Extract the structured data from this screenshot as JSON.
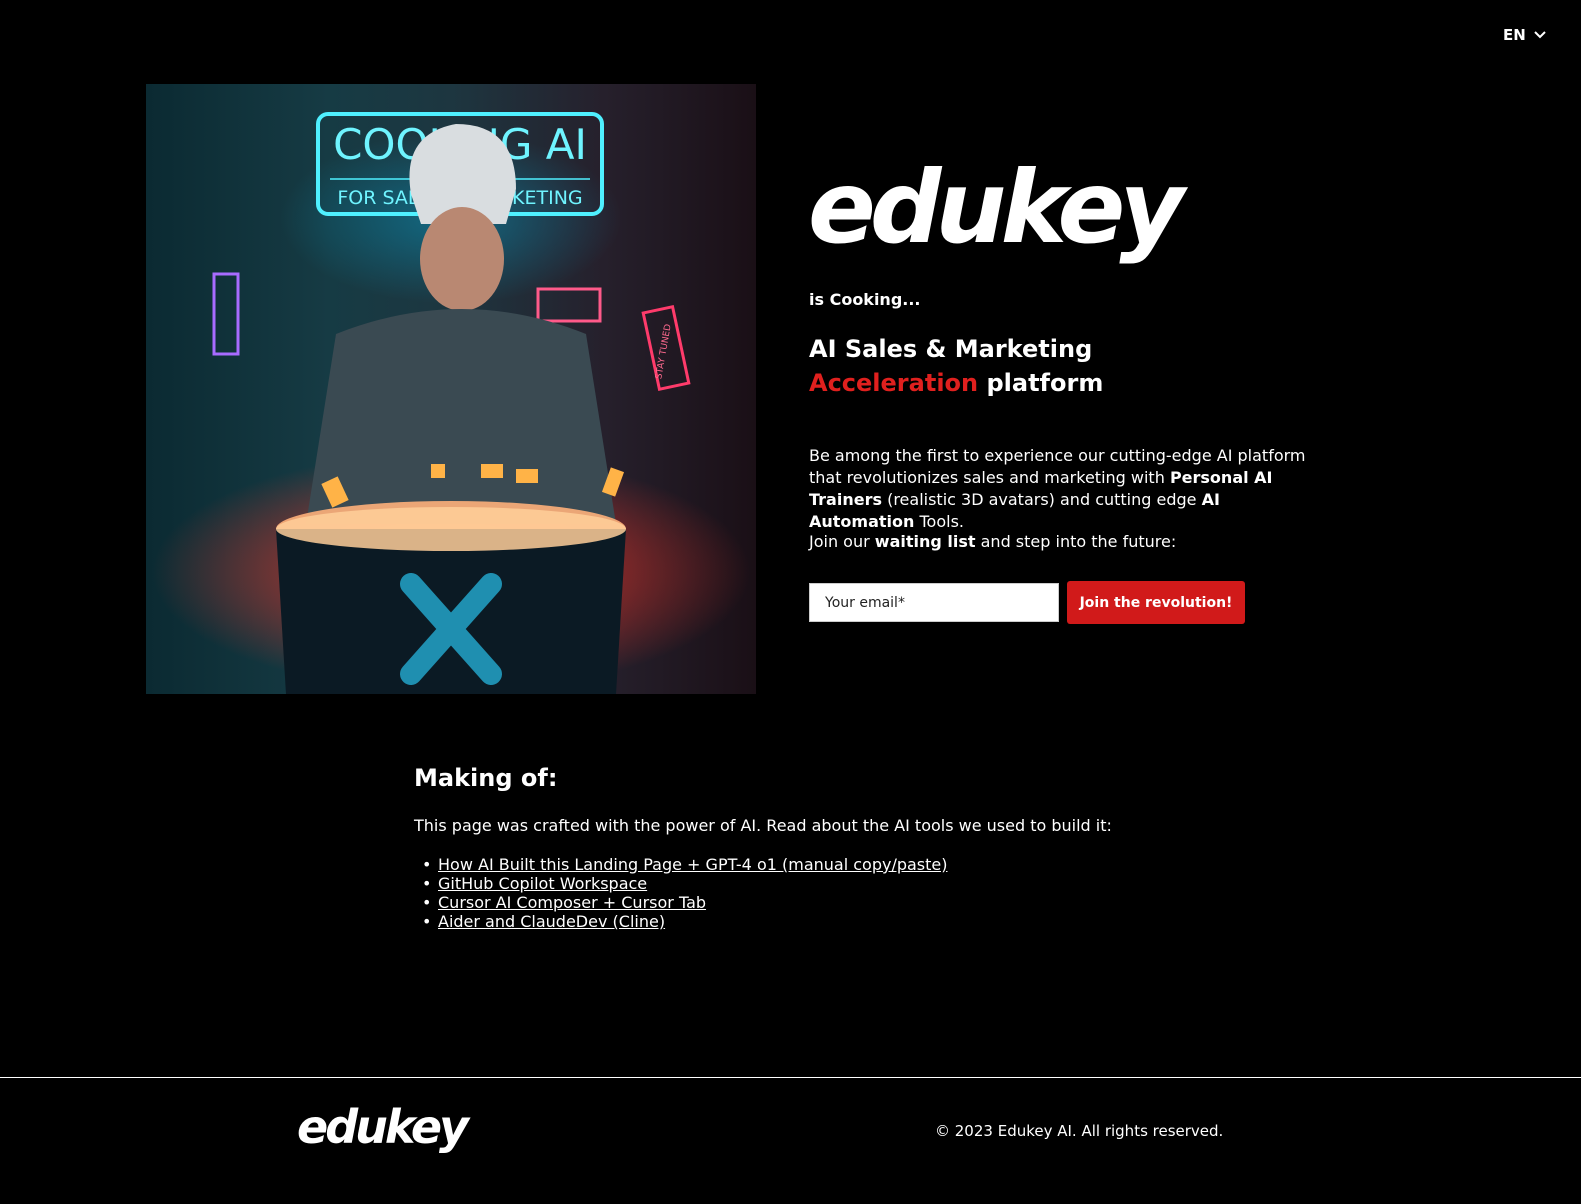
{
  "language": {
    "label": "EN"
  },
  "hero": {
    "brand": "edukey",
    "tagline": "is Cooking...",
    "headline_line1": "AI Sales & Marketing",
    "headline_accent": "Acceleration",
    "headline_rest": "platform",
    "description": [
      "Be among the first to experience our cutting-edge AI platform that revolutionizes sales and marketing with ",
      "Personal AI Trainers",
      " (realistic 3D avatars) and cutting edge ",
      "AI Automation",
      " Tools."
    ],
    "join": [
      "Join our ",
      "waiting list",
      " and step into the future:"
    ],
    "email_placeholder": "Your email*",
    "cta": "Join the revolution!",
    "image": {
      "neon_sign_top": "COOKING AI",
      "neon_sign_sub": "FOR SALES & MARKETING",
      "neon_sign_side": "STAY TUNED"
    }
  },
  "making_of": {
    "title": "Making of:",
    "text": "This page was crafted with the power of AI. Read about the AI tools we used to build it:",
    "links": [
      "How AI Built this Landing Page + GPT-4 o1 (manual copy/paste)",
      "GitHub Copilot Workspace",
      "Cursor AI Composer + Cursor Tab",
      "Aider and ClaudeDev (Cline)"
    ]
  },
  "footer": {
    "brand": "edukey",
    "copyright": "© 2023 Edukey AI. All rights reserved."
  },
  "colors": {
    "accent": "#e0201e",
    "button": "#d11a1a",
    "background": "#000000"
  }
}
